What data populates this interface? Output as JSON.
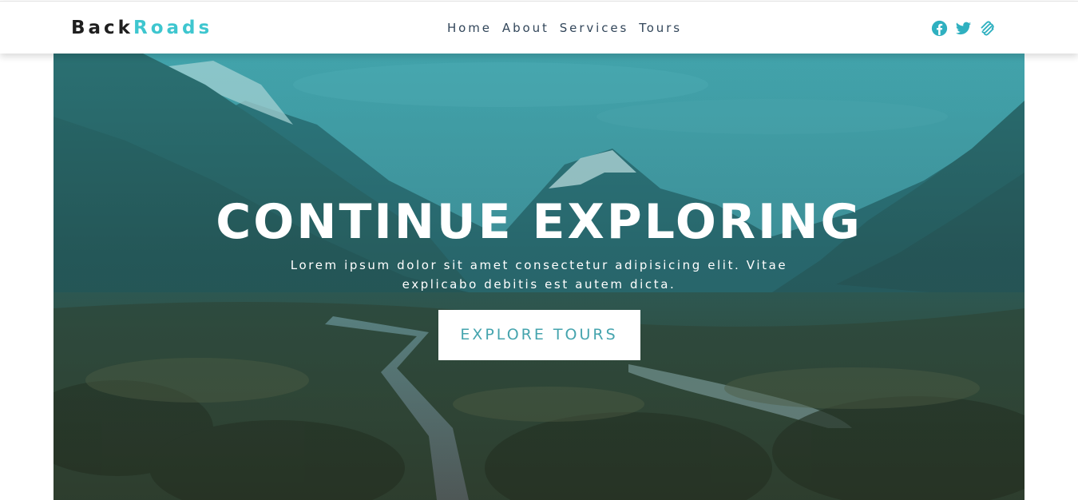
{
  "brand": {
    "part1": "Back",
    "part2": "Roads",
    "accent_color": "#3ec6cf"
  },
  "nav": {
    "links": [
      {
        "label": "Home"
      },
      {
        "label": "About"
      },
      {
        "label": "Services"
      },
      {
        "label": "Tours"
      }
    ]
  },
  "social": {
    "icons": [
      "facebook-icon",
      "twitter-icon",
      "squarespace-icon"
    ],
    "color": "#2fb0c0"
  },
  "hero": {
    "title": "CONTINUE EXPLORING",
    "text": "Lorem ipsum dolor sit amet consectetur adipisicing elit. Vitae explicabo debitis est autem dicta.",
    "button_label": "EXPLORE TOURS",
    "button_color": "#45a4ae"
  }
}
